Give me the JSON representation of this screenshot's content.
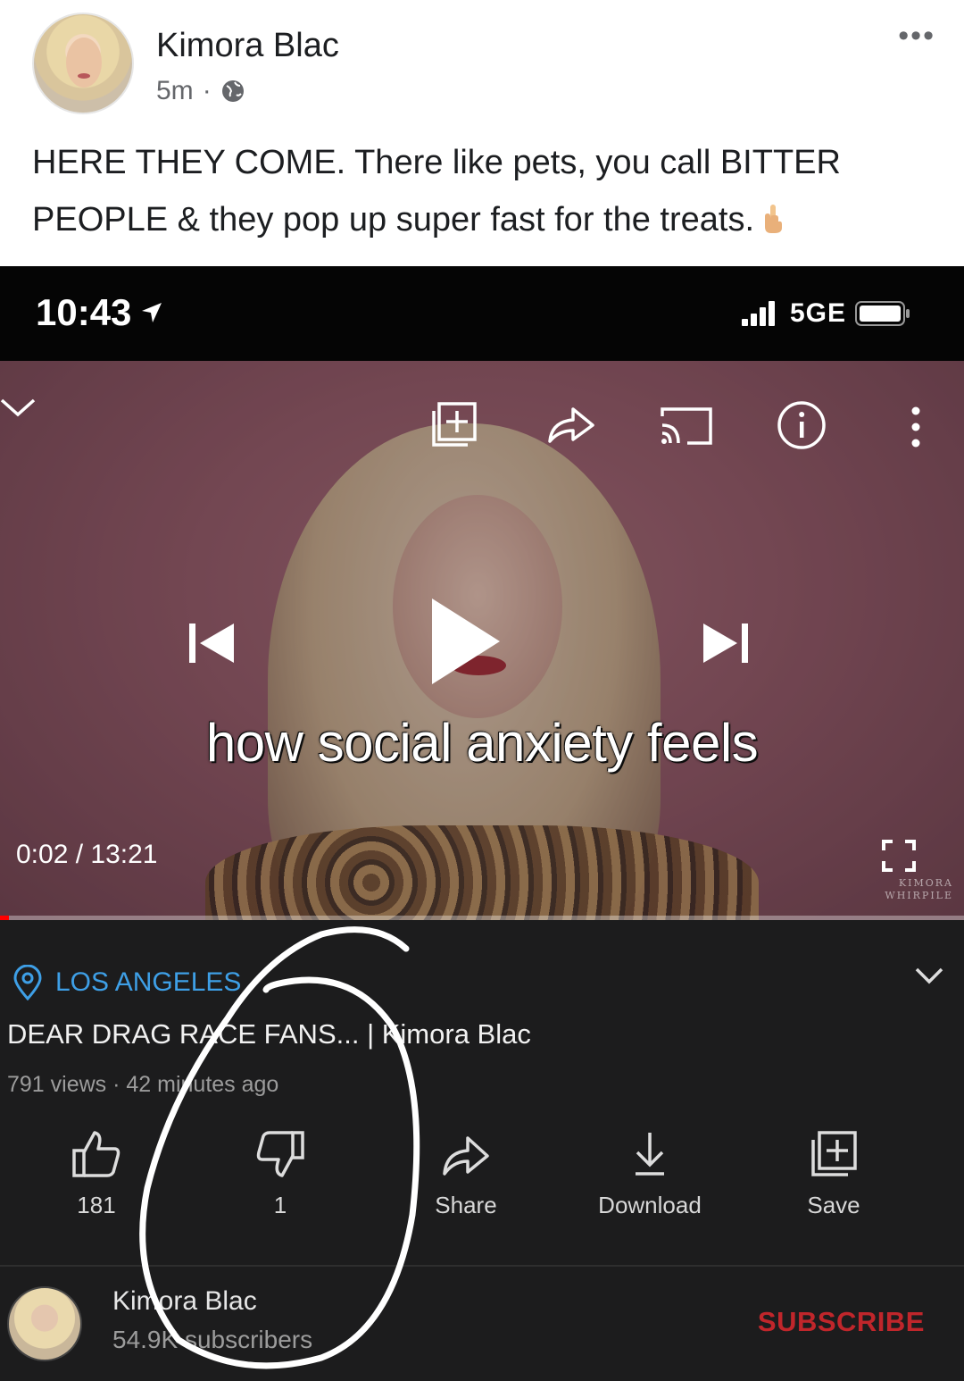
{
  "post": {
    "author": "Kimora Blac",
    "time": "5m",
    "dot": "·",
    "text": "HERE THEY COME. There like pets, you call BITTER PEOPLE & they pop up super fast for the treats."
  },
  "status_bar": {
    "time": "10:43",
    "network": "5GE"
  },
  "video": {
    "caption": "how social anxiety feels",
    "current_time": "0:02",
    "separator": " / ",
    "duration": "13:21",
    "progress_fraction": 0.0025,
    "watermark_line1": "KIMORA",
    "watermark_line2": "WHIRPILE"
  },
  "info": {
    "location": "LOS ANGELES",
    "title": "DEAR DRAG RACE FANS... | Kimora Blac",
    "views": "791 views",
    "meta_sep": " · ",
    "age": "42 minutes ago",
    "actions": {
      "like": "181",
      "dislike": "1",
      "share": "Share",
      "download": "Download",
      "save": "Save"
    },
    "channel": {
      "name": "Kimora Blac",
      "subscribers": "54.9K subscribers",
      "subscribe_label": "SUBSCRIBE"
    }
  },
  "colors": {
    "accent_blue": "#3e9fe6",
    "subscribe_red": "#c0262b",
    "progress_red": "#ff0000"
  }
}
